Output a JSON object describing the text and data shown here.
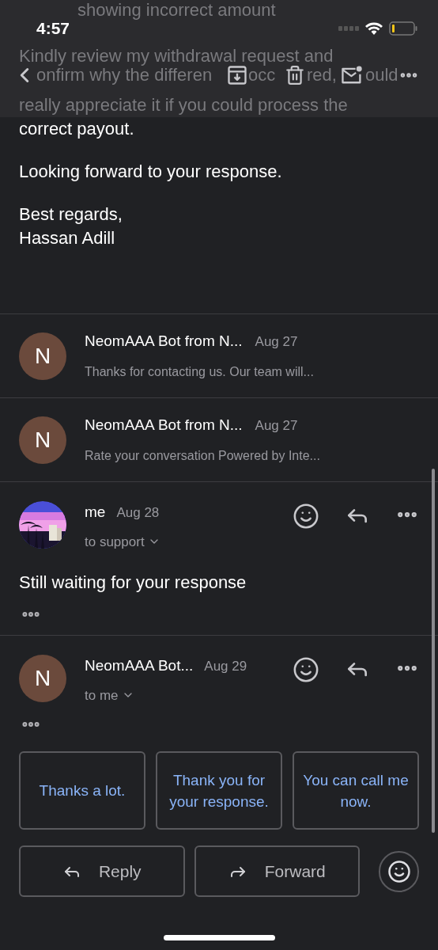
{
  "status_bar": {
    "time": "4:57"
  },
  "faded_text": {
    "line_1": "showing incorrect amount",
    "line_2": "Kindly review my withdrawal request and",
    "line_3_fragments": [
      "onfirm why the differen",
      "occ",
      "red,",
      "ould"
    ],
    "line_4": "really appreciate it if you could process the"
  },
  "body": [
    [
      "correct payout."
    ],
    [
      "Looking forward to your response."
    ],
    [
      "Best regards,",
      "Hassan Adill"
    ]
  ],
  "collapsed_messages": [
    {
      "initial": "N",
      "sender": "NeomAAA Bot from N...",
      "date": "Aug 27",
      "snippet": "Thanks for contacting us. Our team will..."
    },
    {
      "initial": "N",
      "sender": "NeomAAA Bot from N...",
      "date": "Aug 27",
      "snippet": "Rate your conversation Powered by Inte..."
    }
  ],
  "messages": [
    {
      "kind": "picture",
      "sender": "me",
      "date": "Aug 28",
      "recipient": "to support",
      "body": "Still waiting for your response"
    },
    {
      "kind": "initial",
      "initial": "N",
      "sender": "NeomAAA Bot...",
      "date": "Aug 29",
      "recipient": "to me"
    }
  ],
  "smart_replies": [
    "Thanks a lot.",
    "Thank you for your response.",
    "You can call me now."
  ],
  "actions": [
    {
      "kind": "reply",
      "label": "Reply"
    },
    {
      "kind": "forward",
      "label": "Forward"
    }
  ]
}
